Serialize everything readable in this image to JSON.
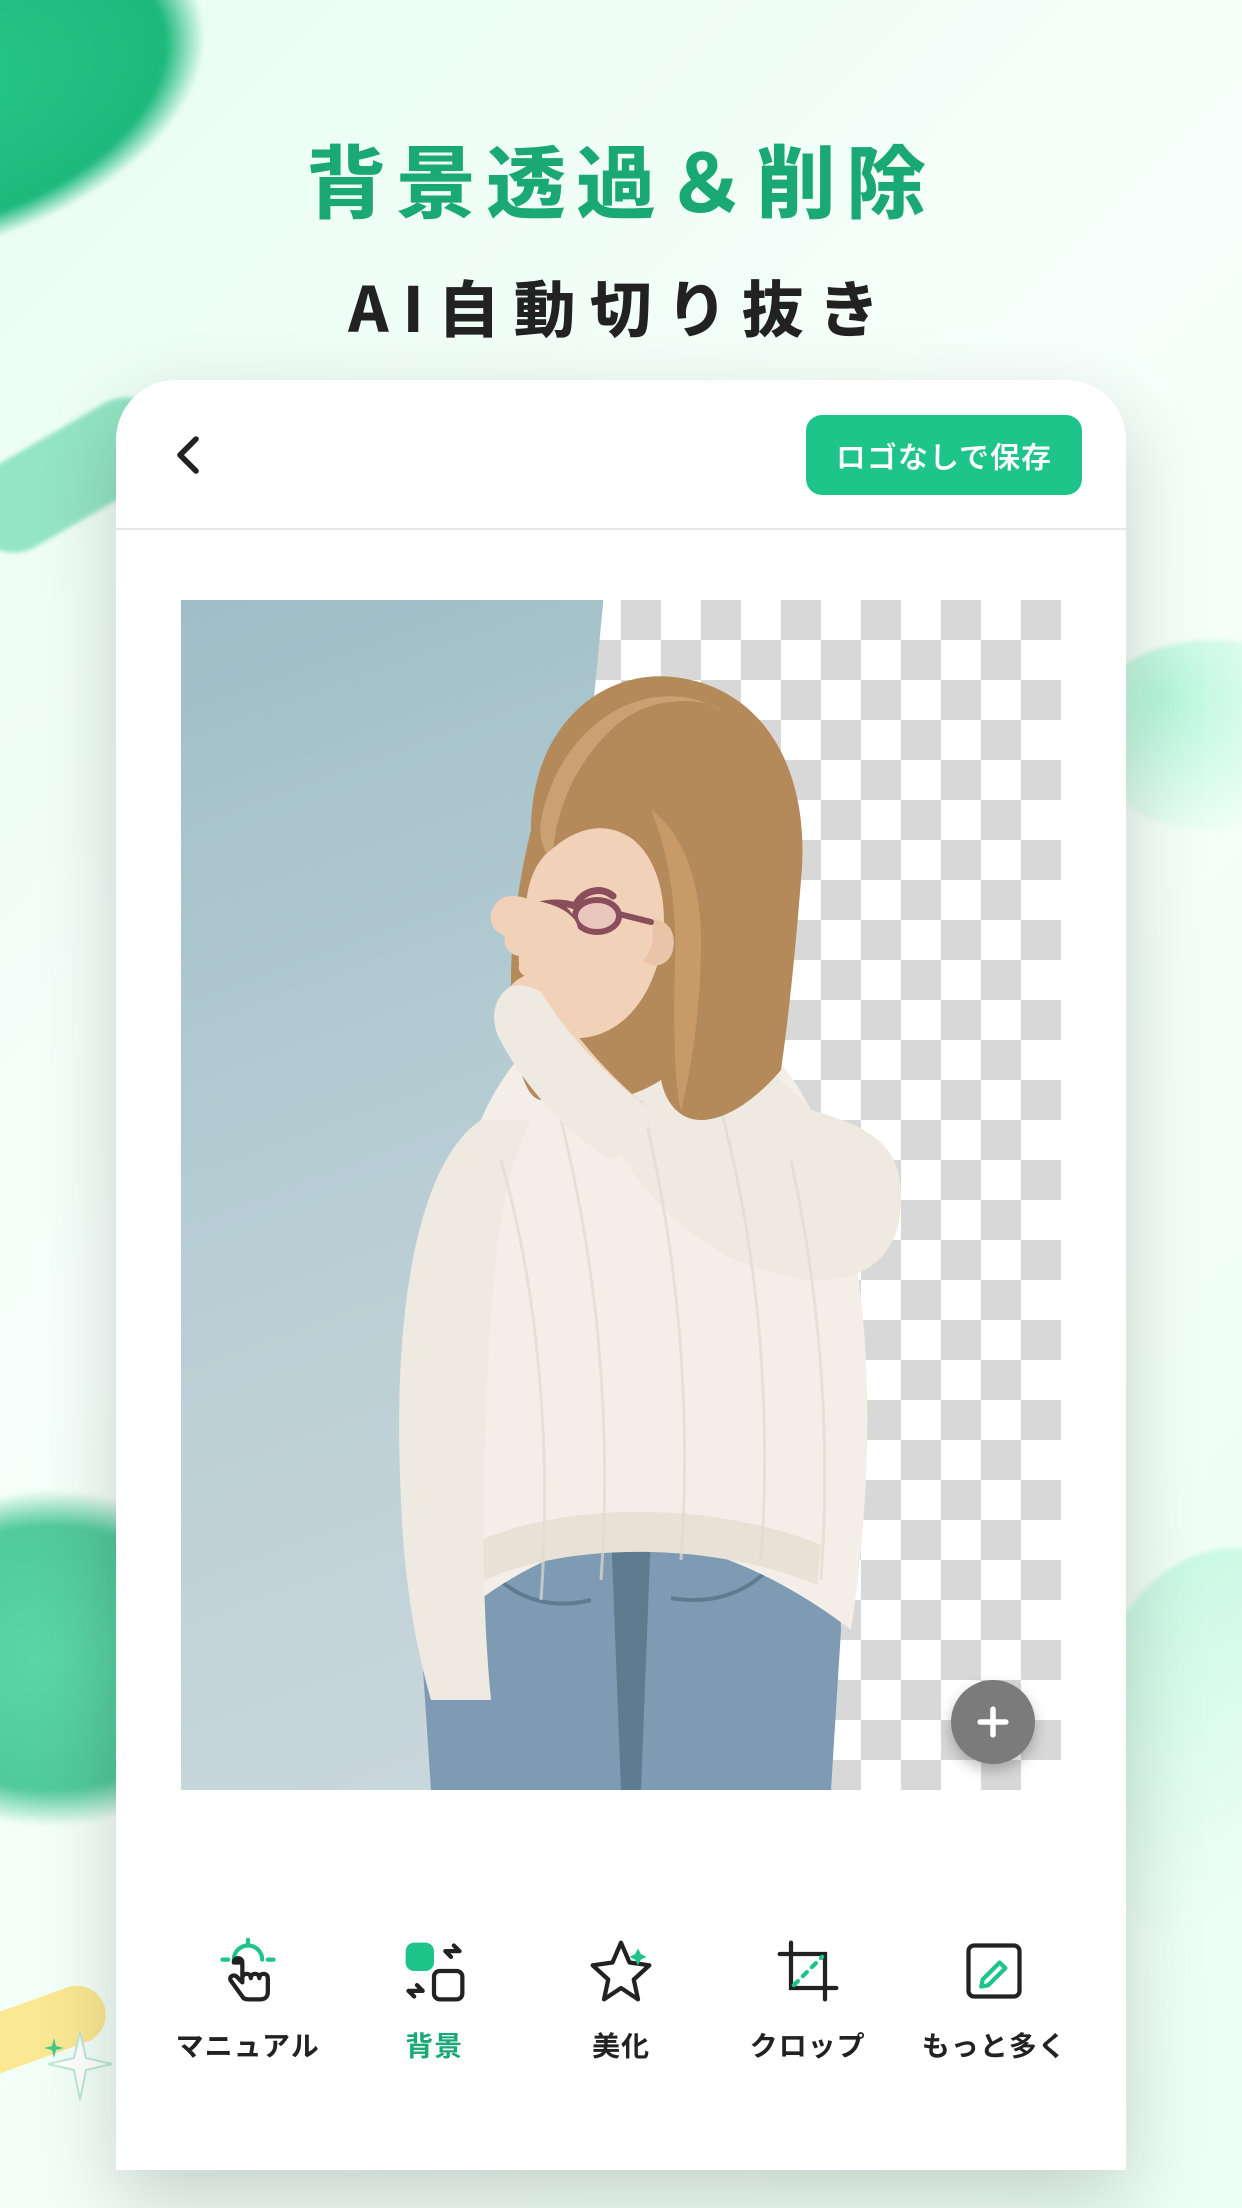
{
  "colors": {
    "accent": "#1fc48a",
    "accent_dark": "#1aa874",
    "text": "#222222",
    "fab": "#7b7b7b"
  },
  "headline": {
    "line1": "背景透過＆削除",
    "line2": "AI自動切り抜き"
  },
  "navbar": {
    "back_icon": "chevron-left-icon",
    "save_label": "ロゴなしで保存"
  },
  "canvas": {
    "fab_icon": "plus-icon"
  },
  "toolbar": {
    "items": [
      {
        "id": "manual",
        "label": "マニュアル",
        "icon": "tap-icon",
        "active": false
      },
      {
        "id": "background",
        "label": "背景",
        "icon": "swap-bg-icon",
        "active": true
      },
      {
        "id": "beautify",
        "label": "美化",
        "icon": "star-icon",
        "active": false
      },
      {
        "id": "crop",
        "label": "クロップ",
        "icon": "crop-icon",
        "active": false
      },
      {
        "id": "more",
        "label": "もっと多く",
        "icon": "edit-icon",
        "active": false
      }
    ]
  }
}
